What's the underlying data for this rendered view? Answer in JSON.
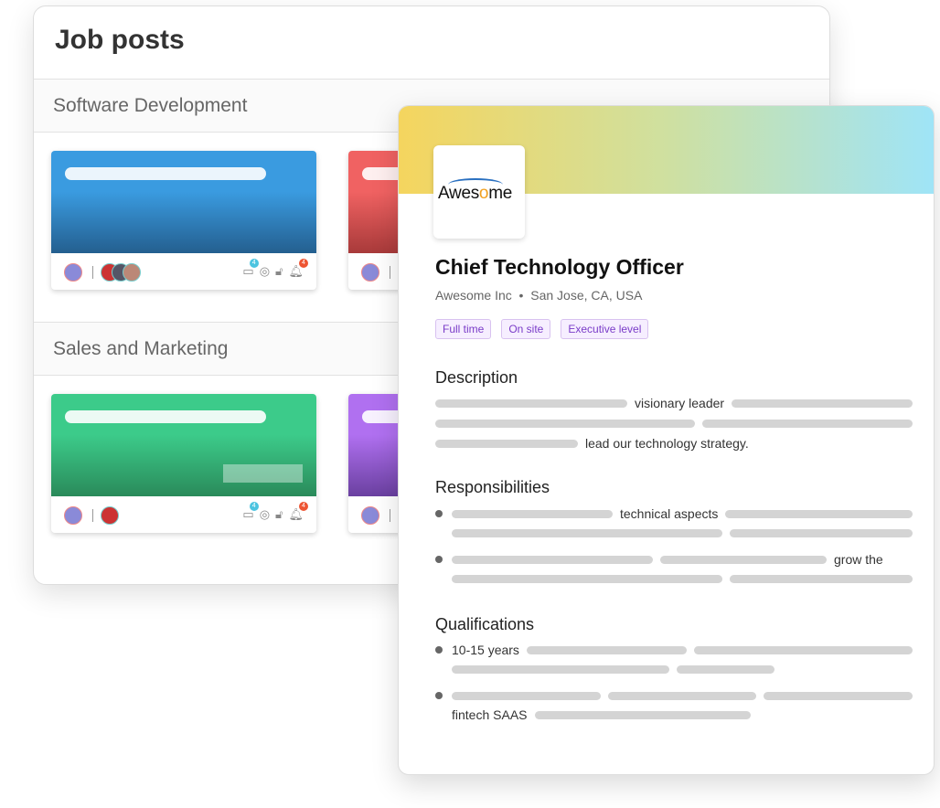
{
  "board": {
    "title": "Job posts",
    "sections": [
      {
        "name": "Software Development"
      },
      {
        "name": "Sales and Marketing"
      }
    ],
    "badges": {
      "calendar": "4",
      "bell": "4"
    },
    "colors": {
      "blue": "#3a9be0",
      "red": "#f06262",
      "green": "#3ccb8a",
      "purple": "#b070f0"
    }
  },
  "job": {
    "logo_text": "Awesome",
    "title": "Chief Technology Officer",
    "company": "Awesome Inc",
    "location": "San Jose, CA, USA",
    "tags": [
      "Full time",
      "On site",
      "Executive level"
    ],
    "description": {
      "heading": "Description",
      "snippets": [
        "visionary leader",
        "lead our technology strategy."
      ]
    },
    "responsibilities": {
      "heading": "Responsibilities",
      "snippets": [
        "technical aspects",
        "grow the"
      ]
    },
    "qualifications": {
      "heading": "Qualifications",
      "snippets": [
        "10-15 years",
        "fintech SAAS"
      ]
    },
    "accent": "#7a3cc8"
  }
}
